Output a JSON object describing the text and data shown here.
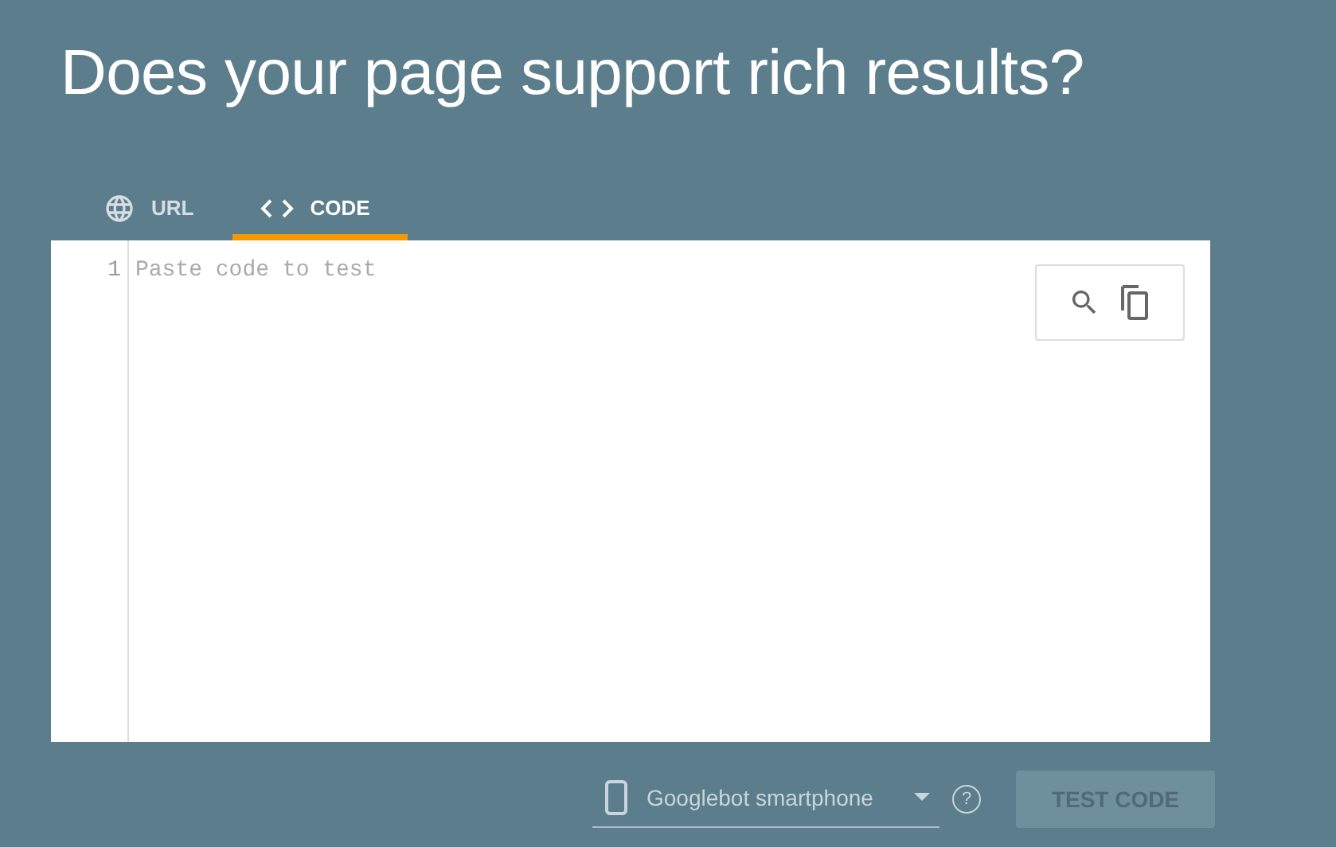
{
  "title": "Does your page support rich results?",
  "tabs": [
    {
      "kind": "url",
      "label": "URL",
      "selected": false
    },
    {
      "kind": "code",
      "label": "CODE",
      "selected": true
    }
  ],
  "editor": {
    "line_numbers": [
      "1"
    ],
    "placeholder": "Paste code to test"
  },
  "device_select": {
    "value": "Googlebot smartphone"
  },
  "help": "?",
  "test_button": {
    "label": "TEST CODE",
    "disabled": true
  }
}
